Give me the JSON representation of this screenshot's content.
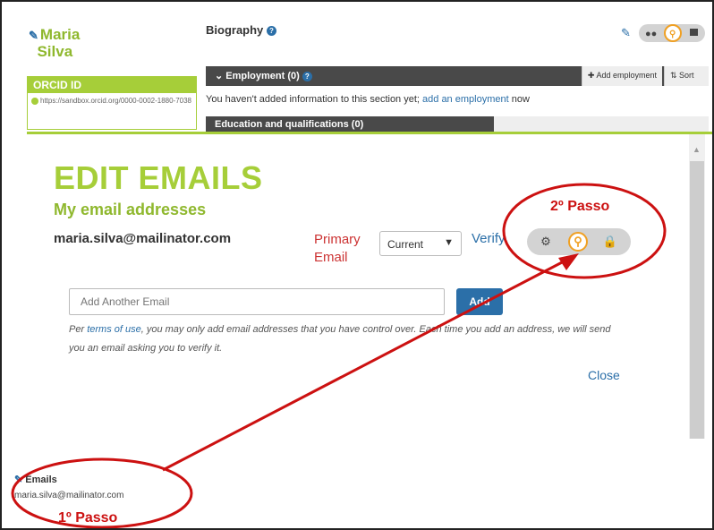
{
  "profile": {
    "name_line1": "Maria",
    "name_line2": "Silva",
    "orcid_header": "ORCID ID",
    "orcid_url": "https://sandbox.orcid.org/0000-0002-1880-7038",
    "biography_label": "Biography"
  },
  "employment": {
    "header": "Employment (0)",
    "add_label": "Add employment",
    "sort_label": "Sort",
    "empty_text": "You haven't added information to this section yet; ",
    "add_link": "add an employment",
    "empty_suffix": " now"
  },
  "education": {
    "header": "Education and qualifications (0)"
  },
  "modal": {
    "title": "EDIT EMAILS",
    "subtitle": "My email addresses",
    "email": "maria.silva@mailinator.com",
    "primary_line1": "Primary",
    "primary_line2": "Email",
    "select_value": "Current",
    "verify_label": "Verify",
    "add_placeholder": "Add Another Email",
    "add_button": "Add",
    "terms_prefix": "Per ",
    "terms_link": "terms of use",
    "terms_suffix": ", you may only add email addresses that you have control over. Each time you add an address, we will send you an email asking you to verify it.",
    "close_label": "Close"
  },
  "emails_section": {
    "label": "Emails",
    "value": "maria.silva@mailinator.com"
  },
  "annotations": {
    "step1": "1º Passo",
    "step2": "2º Passo",
    "color": "#cc1111"
  },
  "colors": {
    "brand_green": "#a6ce39",
    "link_blue": "#2b6fa8",
    "key_orange": "#f0a022"
  }
}
